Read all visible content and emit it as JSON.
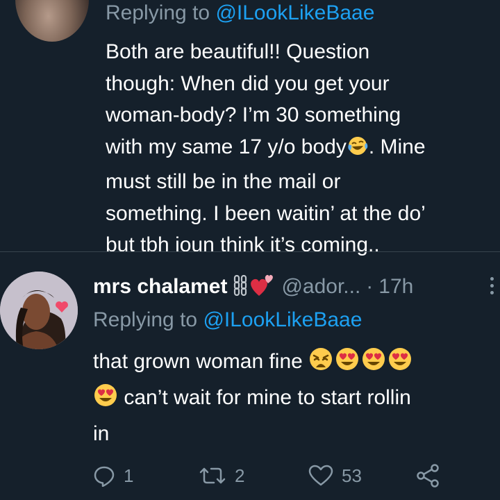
{
  "colors": {
    "background": "#15202b",
    "text_primary": "#ffffff",
    "text_secondary": "#8899a6",
    "link": "#1da1f2",
    "divider": "#38444d"
  },
  "tweet1": {
    "replying_prefix": "Replying to ",
    "replying_handle": "@ILookLikeBaae",
    "body_lines": [
      "Both are beautiful!! Question",
      "though: When did you get your",
      "woman-body? I’m 30 something",
      "with my same 17 y/o body",
      ". Mine",
      "must still be in the mail or",
      "something. I been waitin’ at the do’",
      "but tbh ioun think it’s coming.."
    ],
    "emoji": "face-with-tears-of-joy"
  },
  "tweet2": {
    "display_name": "mrs chalamet",
    "name_emojis": [
      "chains",
      "heart-exclamation"
    ],
    "handle": "@ador...",
    "separator": "·",
    "time": "17h",
    "replying_prefix": "Replying to ",
    "replying_handle": "@ILookLikeBaae",
    "body_part1": "that grown woman fine ",
    "body_emojis_line1": [
      "weary-face",
      "heart-eyes",
      "heart-eyes",
      "heart-eyes"
    ],
    "body_emojis_line2": [
      "heart-eyes"
    ],
    "body_part2": " can’t wait for mine to start rollin",
    "body_part3": "in",
    "actions": {
      "reply_count": "1",
      "retweet_count": "2",
      "like_count": "53"
    },
    "icons": [
      "reply-icon",
      "retweet-icon",
      "like-icon",
      "share-icon",
      "more-icon"
    ]
  }
}
